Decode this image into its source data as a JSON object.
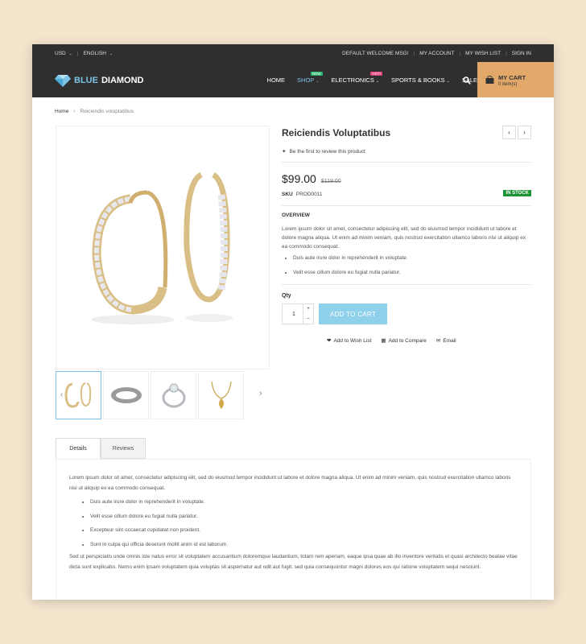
{
  "header": {
    "currency": "USD",
    "language": "ENGLISH",
    "top_links": [
      "DEFAULT WELCOME MSG!",
      "MY ACCOUNT",
      "MY WISH LIST",
      "SIGN IN"
    ],
    "logo_part1": "BLUE",
    "logo_part2": "DIAMOND",
    "nav": [
      {
        "label": "HOME"
      },
      {
        "label": "SHOP",
        "badge": "NEW"
      },
      {
        "label": "ELECTRONICS",
        "badge": "HOT!"
      },
      {
        "label": "SPORTS & BOOKS"
      },
      {
        "label": "SALE"
      }
    ],
    "cart_title": "MY CART",
    "cart_items": "0 item(s)"
  },
  "breadcrumb": {
    "home": "Home",
    "current": "Reiciendis voluptatibus"
  },
  "product": {
    "title": "Reiciendis Voluptatibus",
    "review_text": "Be the first to review this product",
    "price": "$99.00",
    "old_price": "$119.00",
    "sku_label": "SKU",
    "sku": "PROD0011",
    "stock": "IN STOCK",
    "overview_label": "OVERVIEW",
    "overview": "Lorem ipsum dolor sit amet, consectetur adipiscing elit, sed do eiusmod tempor incididunt ut labore et dolore magna aliqua. Ut enim ad minim veniam, quis nostrud exercitation ullamco laboris nisi ut aliquip ex ea commodo consequat.",
    "bullets": [
      "Duis aute irure dolor in reprehenderit in voluptate.",
      "Velit esse cillum dolore eu fugiat nulla pariatur."
    ],
    "qty_label": "Qty",
    "qty": "1",
    "add_to_cart": "ADD TO CART",
    "wishlist": "Add to Wish List",
    "compare": "Add to Compare",
    "email": "Email"
  },
  "tabs": {
    "details": "Details",
    "reviews": "Reviews",
    "intro": "Lorem ipsum dolor sit amet, consectetur adipiscing elit, sed do eiusmod tempor incididunt ut labore et dolore magna aliqua. Ut enim ad minim veniam, quis nostrud exercitation ullamco laboris nisi ut aliquip ex ea commodo consequat.",
    "bullets": [
      "Duis aute irure dolor in reprehenderit in voluptate.",
      "Velit esse cillum dolore eu fugiat nulla pariatur.",
      "Excepteur sint occaecat cupidatat non proident.",
      "Sunt in culpa qui officia deserunt mollit anim id est laborum."
    ],
    "outro": "Sed ut perspiciatis unde omnis iste natus error sit voluptatem accusantium doloremque laudantium, totam rem aperiam, eaque ipsa quae ab illo inventore veritatis et quasi architecto beatae vitae dicta sunt explicabo. Nemo enim ipsam voluptatem quia voluptas sit aspernatur aut odit aut fugit, sed quia consequuntur magni dolores eos qui ratione voluptatem sequi nesciunt."
  },
  "colors": {
    "header_bg": "#2f2f2f",
    "accent": "#7cc3e6",
    "cart_bg": "#e3a96a",
    "instock": "#1b9434"
  }
}
